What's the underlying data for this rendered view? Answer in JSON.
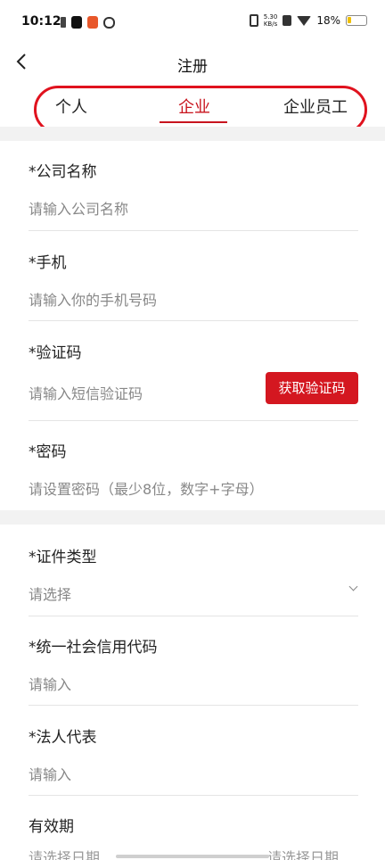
{
  "status": {
    "time": "10:12",
    "speed_top": "5.30",
    "speed_bottom": "KB/s",
    "battery": "18%"
  },
  "nav": {
    "title": "注册"
  },
  "tabs": [
    {
      "label": "个人"
    },
    {
      "label": "企业"
    },
    {
      "label": "企业员工"
    }
  ],
  "form": {
    "company": {
      "label": "*公司名称",
      "placeholder": "请输入公司名称"
    },
    "phone": {
      "label": "*手机",
      "placeholder": "请输入你的手机号码"
    },
    "code": {
      "label": "*验证码",
      "placeholder": "请输入短信验证码",
      "button": "获取验证码"
    },
    "password": {
      "label": "*密码",
      "placeholder": "请设置密码（最少8位，数字+字母）"
    },
    "id_type": {
      "label": "*证件类型",
      "placeholder": "请选择"
    },
    "credit_code": {
      "label": "*统一社会信用代码",
      "placeholder": "请输入"
    },
    "legal_rep": {
      "label": "*法人代表",
      "placeholder": "请输入"
    },
    "validity": {
      "label": "有效期",
      "start_placeholder": "请选择日期",
      "end_placeholder": "请选择日期"
    }
  },
  "colors": {
    "accent": "#c8141e",
    "highlight": "#e0121e"
  }
}
